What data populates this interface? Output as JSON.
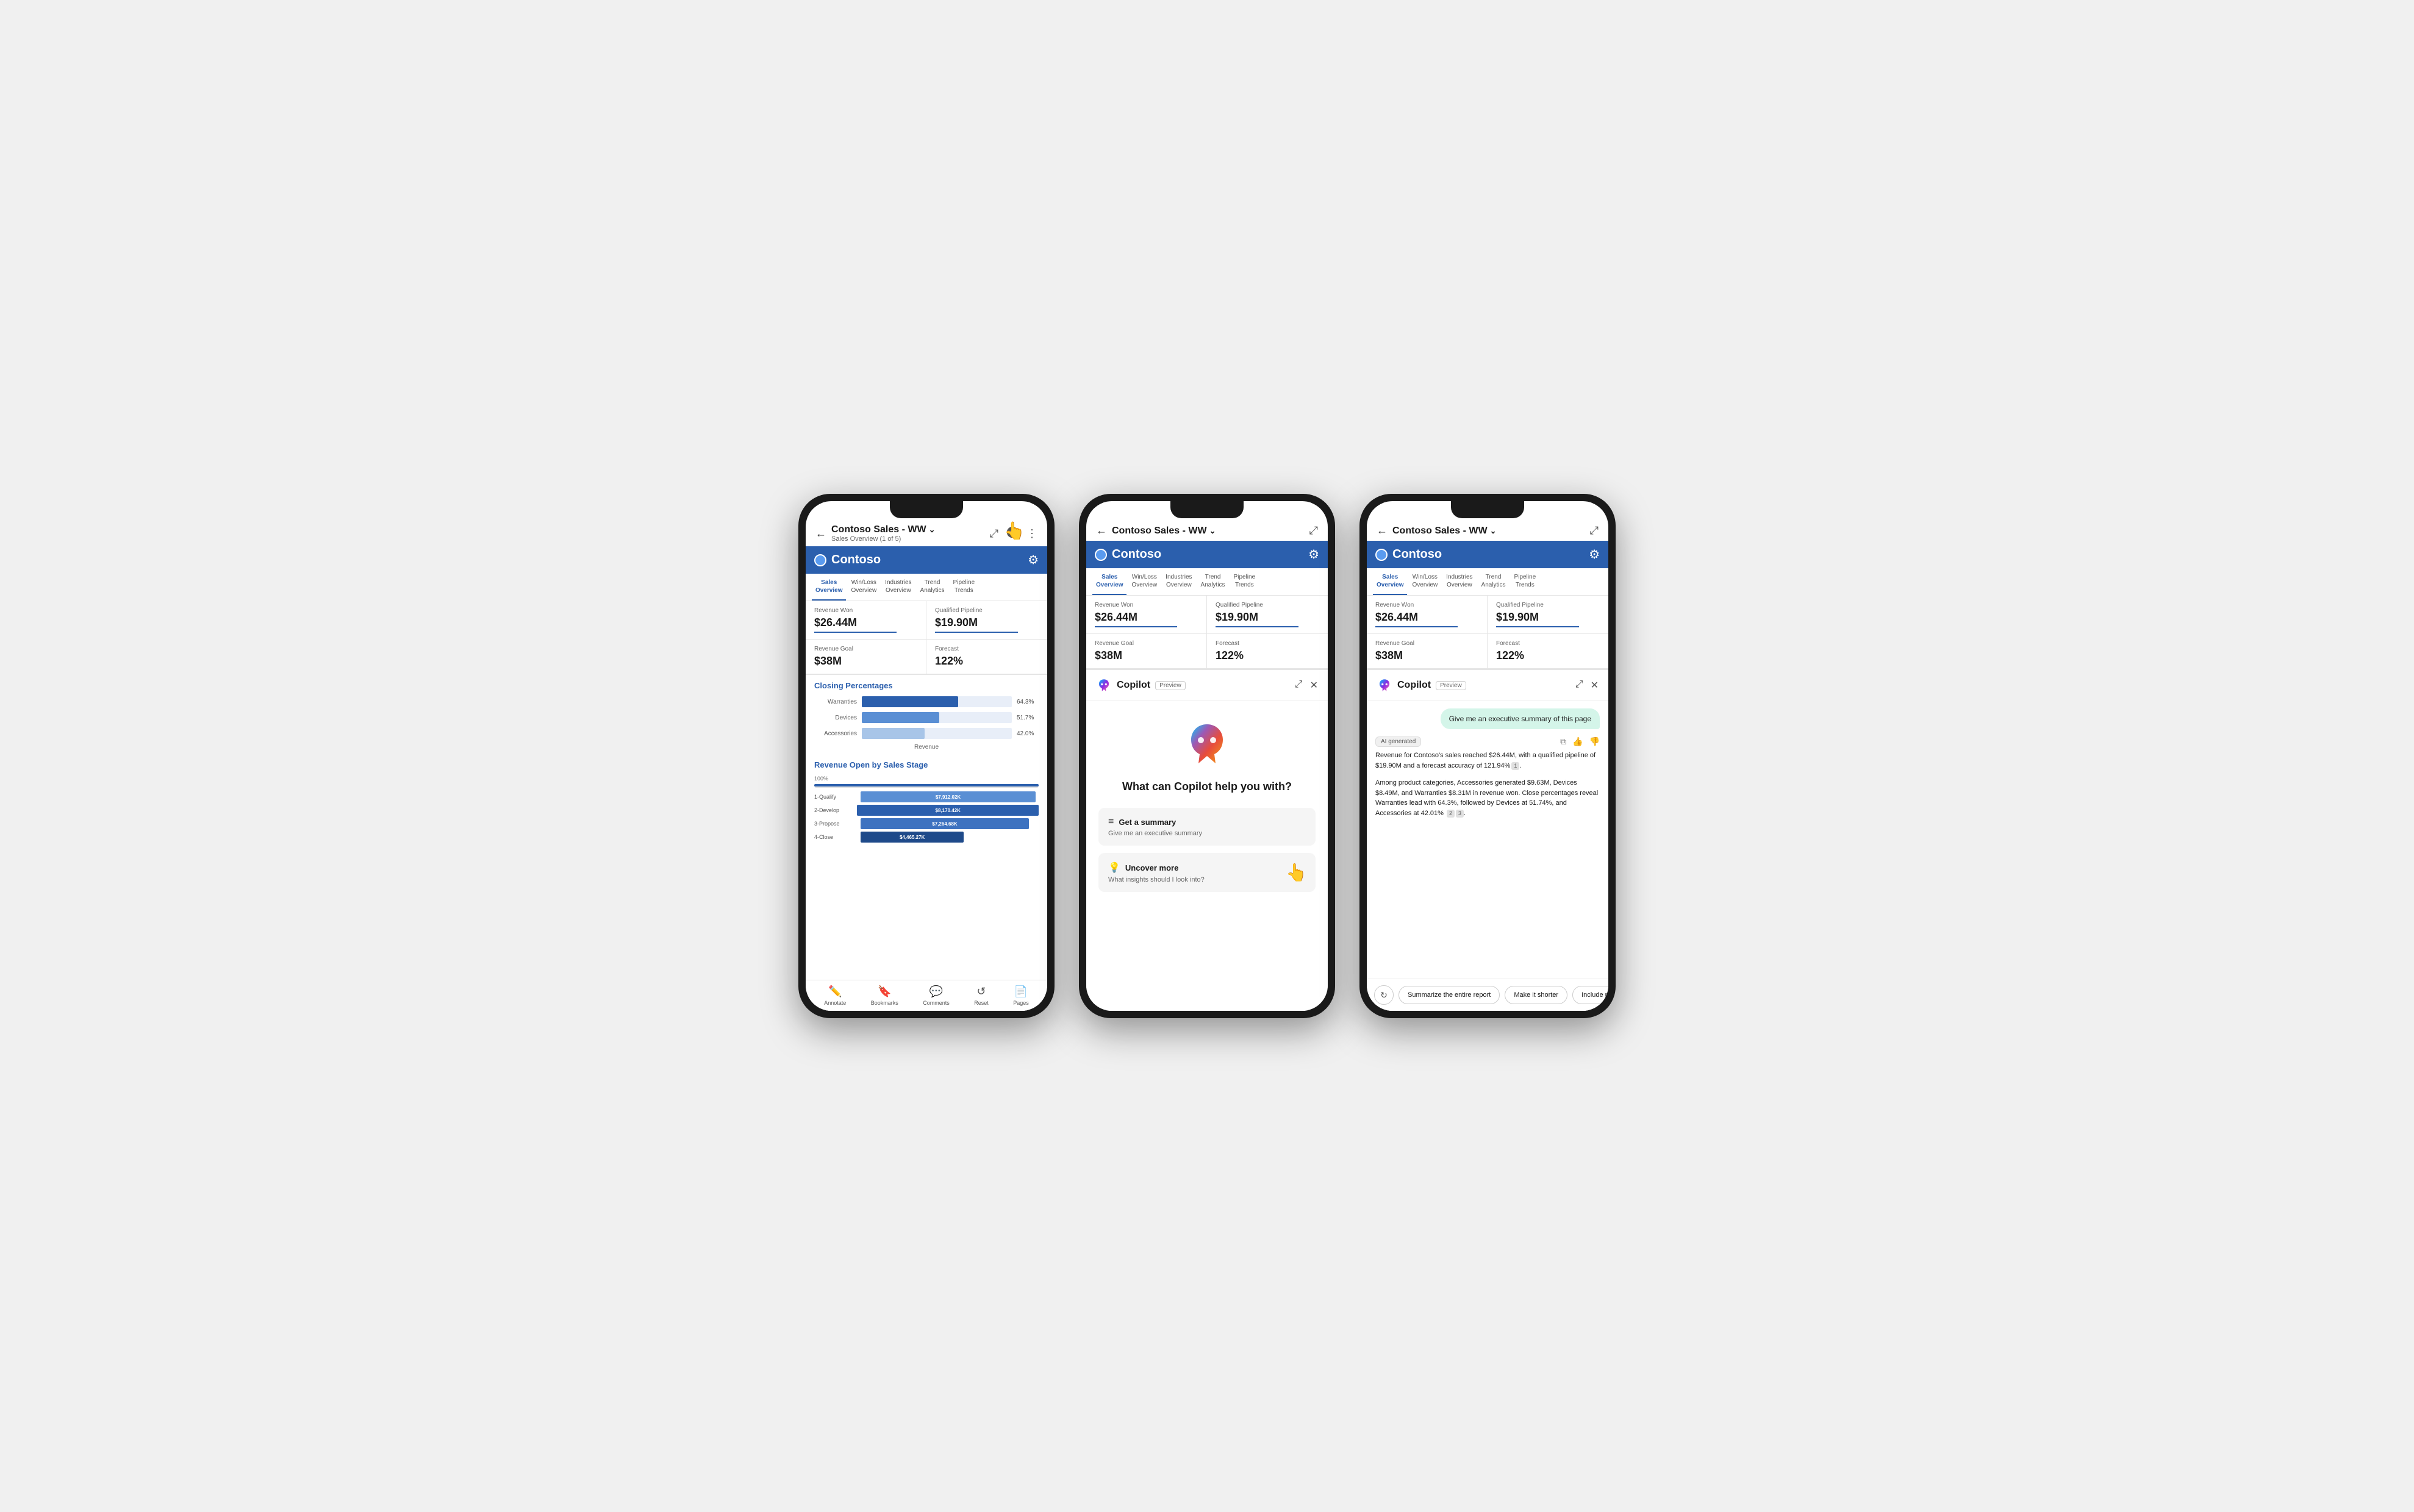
{
  "phones": {
    "phone1": {
      "title": "Contoso Sales - WW",
      "subtitle": "Sales Overview (1 of 5)",
      "brand": "Contoso",
      "nav_tabs": [
        {
          "label": "Sales\nOverview",
          "active": true
        },
        {
          "label": "Win/Loss\nOverview",
          "active": false
        },
        {
          "label": "Industries\nOverview",
          "active": false
        },
        {
          "label": "Trend\nAnalytics",
          "active": false
        },
        {
          "label": "Pipeline\nTrends",
          "active": false
        }
      ],
      "metrics": [
        {
          "label": "Revenue Won",
          "value": "$26.44M"
        },
        {
          "label": "Qualified Pipeline",
          "value": "$19.90M"
        },
        {
          "label": "Revenue Goal",
          "value": "$38M"
        },
        {
          "label": "Forecast",
          "value": "122%"
        }
      ],
      "closing_percentages_title": "Closing Percentages",
      "bars": [
        {
          "label": "Warranties",
          "pct": 64.3,
          "display": "64.3%",
          "type": "dark"
        },
        {
          "label": "Devices",
          "pct": 51.7,
          "display": "51.7%",
          "type": "medium"
        },
        {
          "label": "Accessories",
          "pct": 42.0,
          "display": "42.0%",
          "type": "light"
        }
      ],
      "bar_chart_label": "Revenue",
      "revenue_open_title": "Revenue Open by Sales Stage",
      "stacked_rows": [
        {
          "label": "1-Qualify",
          "value": "$7,912.02K",
          "width": 78
        },
        {
          "label": "2-Develop",
          "value": "$8,170.42K",
          "width": 82
        },
        {
          "label": "3-Propose",
          "value": "$7,264.68K",
          "width": 72
        },
        {
          "label": "4-Close",
          "value": "$4,465.27K",
          "width": 44
        }
      ],
      "bottom_nav": [
        {
          "icon": "✏️",
          "label": "Annotate"
        },
        {
          "icon": "🔖",
          "label": "Bookmarks"
        },
        {
          "icon": "💬",
          "label": "Comments"
        },
        {
          "icon": "↺",
          "label": "Reset"
        },
        {
          "icon": "📄",
          "label": "Pages"
        }
      ]
    },
    "phone2": {
      "title": "Contoso Sales - WW",
      "brand": "Contoso",
      "copilot_title": "Copilot",
      "copilot_preview": "Preview",
      "question": "What can Copilot help you with?",
      "suggestions": [
        {
          "icon": "≡",
          "title": "Get a summary",
          "subtitle": "Give me an executive summary"
        },
        {
          "icon": "💡",
          "title": "Uncover more",
          "subtitle": "What insights should I look into?"
        }
      ],
      "nav_tabs": [
        {
          "label": "Sales\nOverview",
          "active": true
        },
        {
          "label": "Win/Loss\nOverview",
          "active": false
        },
        {
          "label": "Industries\nOverview",
          "active": false
        },
        {
          "label": "Trend\nAnalytics",
          "active": false
        },
        {
          "label": "Pipeline\nTrends",
          "active": false
        }
      ],
      "metrics": [
        {
          "label": "Revenue Won",
          "value": "$26.44M"
        },
        {
          "label": "Qualified Pipeline",
          "value": "$19.90M"
        },
        {
          "label": "Revenue Goal",
          "value": "$38M"
        },
        {
          "label": "Forecast",
          "value": "122%"
        }
      ]
    },
    "phone3": {
      "title": "Contoso Sales - WW",
      "brand": "Contoso",
      "copilot_title": "Copilot",
      "copilot_preview": "Preview",
      "user_message": "Give me an executive summary of this page",
      "ai_badge": "AI generated",
      "response_para1": "Revenue for Contoso's sales reached $26.44M, with a qualified pipeline of $19.90M and a forecast accuracy of 121.94%",
      "response_para2": "Among product categories, Accessories generated $9.63M, Devices $8.49M, and Warranties $8.31M in revenue won. Close percentages reveal Warranties lead with 64.3%, followed by Devices at 51.74%, and Accessories at 42.01%",
      "action_buttons": [
        "Summarize the entire report",
        "Make it shorter",
        "Include more details"
      ],
      "nav_tabs": [
        {
          "label": "Sales\nOverview",
          "active": true
        },
        {
          "label": "Win/Loss\nOverview",
          "active": false
        },
        {
          "label": "Industries\nOverview",
          "active": false
        },
        {
          "label": "Trend\nAnalytics",
          "active": false
        },
        {
          "label": "Pipeline\nTrends",
          "active": false
        }
      ],
      "metrics": [
        {
          "label": "Revenue Won",
          "value": "$26.44M"
        },
        {
          "label": "Qualified Pipeline",
          "value": "$19.90M"
        },
        {
          "label": "Revenue Goal",
          "value": "$38M"
        },
        {
          "label": "Forecast",
          "value": "122%"
        }
      ]
    }
  }
}
